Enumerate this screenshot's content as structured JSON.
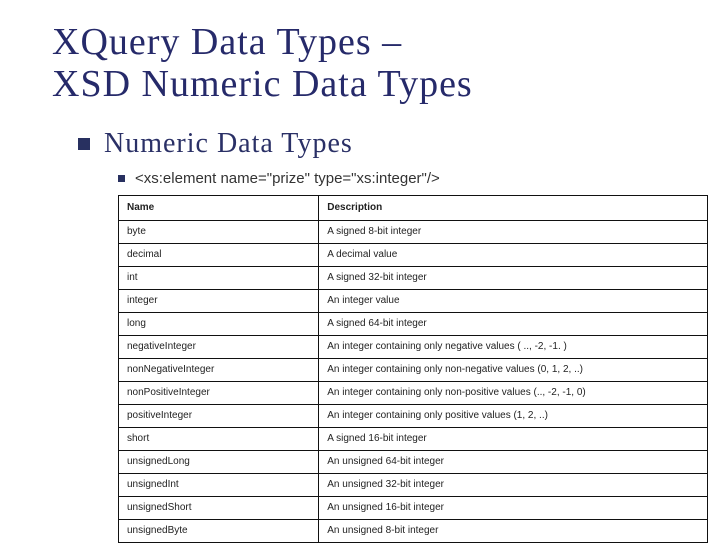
{
  "title_line1": "XQuery Data Types –",
  "title_line2": "XSD Numeric Data Types",
  "subheading": "Numeric Data Types",
  "example": "<xs:element name=\"prize\" type=\"xs:integer\"/>",
  "headers": {
    "name": "Name",
    "description": "Description"
  },
  "rows": [
    {
      "name": "byte",
      "desc": "A signed 8-bit integer"
    },
    {
      "name": "decimal",
      "desc": "A decimal value"
    },
    {
      "name": "int",
      "desc": "A signed 32-bit integer"
    },
    {
      "name": "integer",
      "desc": "An integer value"
    },
    {
      "name": "long",
      "desc": "A signed 64-bit integer"
    },
    {
      "name": "negativeInteger",
      "desc": "An integer containing only negative values ( .., -2, -1. )"
    },
    {
      "name": "nonNegativeInteger",
      "desc": "An integer containing only non-negative values (0, 1, 2, ..)"
    },
    {
      "name": "nonPositiveInteger",
      "desc": "An integer containing only non-positive values (.., -2, -1, 0)"
    },
    {
      "name": "positiveInteger",
      "desc": "An integer containing only positive values (1, 2, ..)"
    },
    {
      "name": "short",
      "desc": "A signed 16-bit integer"
    },
    {
      "name": "unsignedLong",
      "desc": "An unsigned 64-bit integer"
    },
    {
      "name": "unsignedInt",
      "desc": "An unsigned 32-bit integer"
    },
    {
      "name": "unsignedShort",
      "desc": "An unsigned 16-bit integer"
    },
    {
      "name": "unsignedByte",
      "desc": "An unsigned 8-bit integer"
    }
  ]
}
